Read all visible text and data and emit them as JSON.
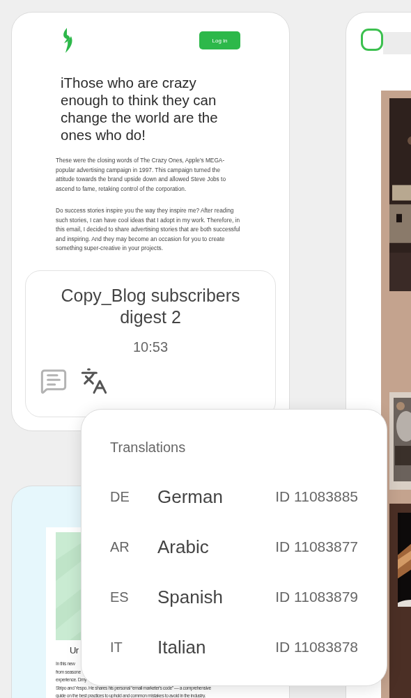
{
  "cards": [
    {
      "kind": "digest",
      "login_button": "Log in",
      "heading": "iThose who are crazy enough to think they can change the world are the ones who do!",
      "paragraphs": [
        "These were the closing words of The Crazy Ones, Apple's MEGA-popular advertising campaign in 1997. This campaign turned the attitude towards the brand upside down and allowed Steve Jobs to ascend to fame, retaking control of the corporation.",
        "Do success stories inspire you the way they inspire me? After reading such stories, I can have cool ideas that I adopt in my work. Therefore, in this email, I decided to share advertising stories that are both successful and inspiring. And they may become an occasion for you to create something super-creative in your projects."
      ],
      "title": "Copy_Blog subscribers digest 2",
      "time": "10:53"
    },
    {
      "kind": "cafe",
      "checked": false
    },
    {
      "kind": "guide",
      "heading": "Ur",
      "lines": [
        "In this new",
        "from seasone",
        "experience. Dmy",
        "Stripo and Yespo. He shares his personal “email marketer's code” — a comprehensive",
        "guide on the best practices to uphold and common mistakes to avoid in the industry."
      ]
    }
  ],
  "translations": {
    "title": "Translations",
    "items": [
      {
        "code": "DE",
        "language": "German",
        "id": "ID 11083885"
      },
      {
        "code": "AR",
        "language": "Arabic",
        "id": "ID 11083877"
      },
      {
        "code": "ES",
        "language": "Spanish",
        "id": "ID 11083879"
      },
      {
        "code": "IT",
        "language": "Italian",
        "id": "ID 11083878"
      }
    ]
  }
}
